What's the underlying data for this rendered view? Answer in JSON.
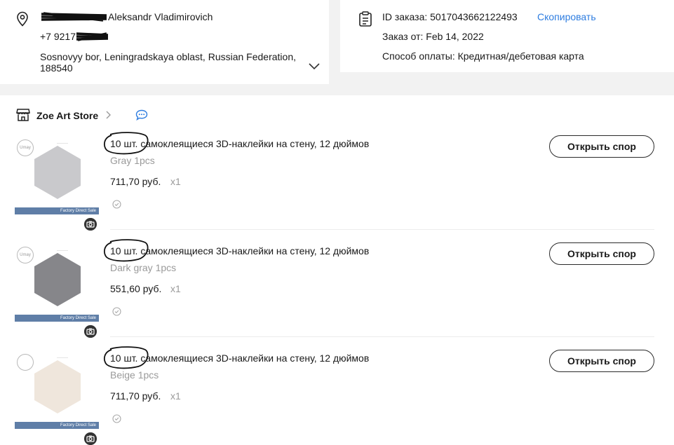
{
  "address": {
    "name": "Aleksandr Vladimirovich",
    "phone": "+7 9217",
    "location_line1": "Sosnovyy bor, Leningradskaya oblast, Russian Federation,",
    "location_line2": "188540"
  },
  "order": {
    "id_label": "ID заказа: 5017043662122493",
    "copy_label": "Скопировать",
    "date_label": "Заказ от: Feb 14, 2022",
    "payment_label": "Способ оплаты: Кредитная/дебетовая карта"
  },
  "store": {
    "name": "Zoe Art Store"
  },
  "items": [
    {
      "qty": "10 шт.",
      "title_rest": " самоклеящиеся 3D-наклейки на стену, 12 дюймов",
      "variant": "Gray 1pcs",
      "price": "711,70 руб.",
      "count": "x1",
      "button": "Открыть спор",
      "thumb_circle": "Umay",
      "thumb_brand": "Factory Direct Sale",
      "tile_color": "#c9c9cc"
    },
    {
      "qty": "10 шт.",
      "title_rest": " самоклеящиеся 3D-наклейки на стену, 12 дюймов",
      "variant": "Dark gray 1pcs",
      "price": "551,60 руб.",
      "count": "x1",
      "button": "Открыть спор",
      "thumb_circle": "Umay",
      "thumb_brand": "Factory Direct Sale",
      "tile_color": "#86868a"
    },
    {
      "qty": "10 шт.",
      "title_rest": " самоклеящиеся 3D-наклейки на стену, 12 дюймов",
      "variant": "Beige 1pcs",
      "price": "711,70 руб.",
      "count": "x1",
      "button": "Открыть спор",
      "thumb_circle": "",
      "thumb_brand": "Factory Direct Sale",
      "tile_color": "#efe6dc"
    }
  ]
}
